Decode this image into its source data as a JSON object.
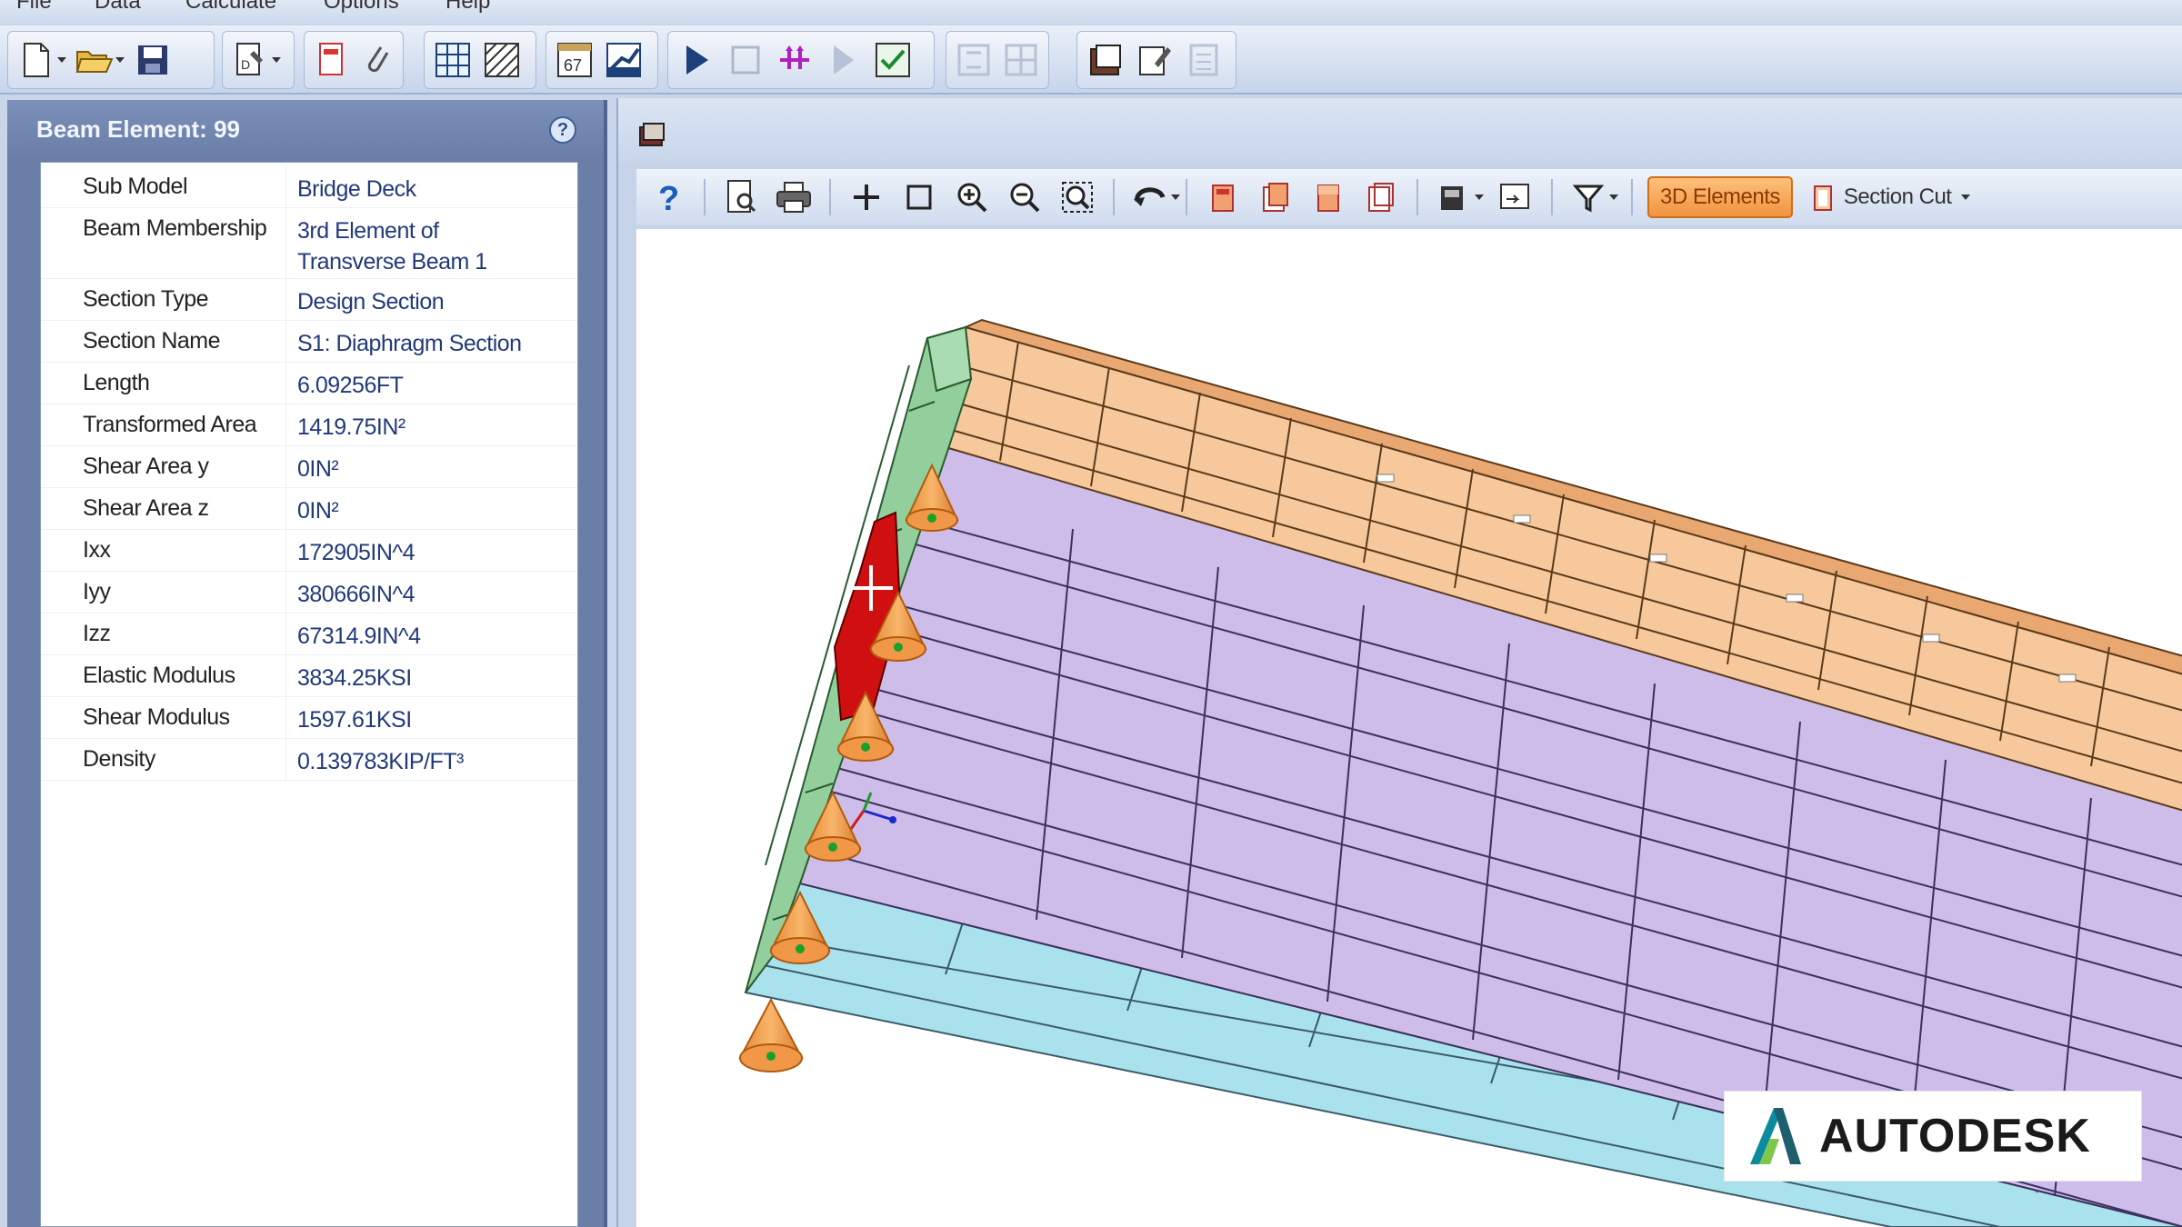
{
  "menu": {
    "items": [
      "File",
      "Data",
      "Calculate",
      "Options",
      "Help"
    ]
  },
  "panel": {
    "title": "Beam Element: 99",
    "properties": [
      {
        "label": "Sub Model",
        "value": "Bridge Deck"
      },
      {
        "label": "Beam Membership",
        "value": "3rd Element of\nTransverse Beam 1"
      },
      {
        "label": "Section Type",
        "value": "Design Section"
      },
      {
        "label": "Section Name",
        "value": "S1: Diaphragm Section"
      },
      {
        "label": "Length",
        "value": "6.09256FT"
      },
      {
        "label": "Transformed Area",
        "value": "1419.75IN²"
      },
      {
        "label": "Shear Area y",
        "value": "0IN²"
      },
      {
        "label": "Shear Area z",
        "value": "0IN²"
      },
      {
        "label": "Ixx",
        "value": "172905IN^4"
      },
      {
        "label": "Iyy",
        "value": "380666IN^4"
      },
      {
        "label": "Izz",
        "value": "67314.9IN^4"
      },
      {
        "label": "Elastic Modulus",
        "value": "3834.25KSI"
      },
      {
        "label": "Shear Modulus",
        "value": "1597.61KSI"
      },
      {
        "label": "Density",
        "value": "0.139783KIP/FT³"
      }
    ]
  },
  "view_toolbar": {
    "elements_3d_label": "3D Elements",
    "section_cut_label": "Section Cut"
  },
  "watermark": {
    "brand": "AUTODESK"
  },
  "colors": {
    "selected_element": "#d01010",
    "barrier": "#f5c89a",
    "girders": "#c9b7e6",
    "slab_edge": "#a7e3ee",
    "diaphragm": "#8fcf98",
    "supports": "#f6a24e",
    "button_active": "#f09340"
  }
}
